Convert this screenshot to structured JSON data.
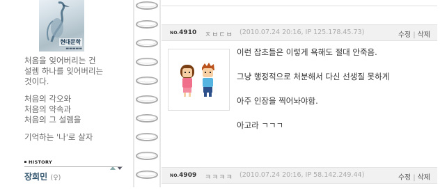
{
  "sidebar": {
    "book_cover": {
      "title": "현대문학"
    },
    "poem": {
      "stanza1": [
        "처음을 잊어버리는 건",
        "설렘 하나를 잊어버리는",
        "것이다."
      ],
      "stanza2": [
        "처음의 각오와",
        "처음의 약속과",
        "처음의 그 설렘을"
      ],
      "stanza3": [
        "기억하는 '나'로 살자"
      ]
    },
    "history": {
      "label": "HISTORY"
    },
    "member": {
      "name": "장희민",
      "gender": "(♀)"
    }
  },
  "posts": [
    {
      "no_prefix": "NO.",
      "no": "4910",
      "author": "ㅈㅂㄷㅂ",
      "meta": "(2010.07.24 20:16, IP 125.178.45.73)",
      "edit": "수정",
      "delete": "삭제",
      "lines": [
        "이런 잡초들은 이렇게 욕해도 절대 안죽음.",
        "그냥 행정적으로 처분해서 다신 선생질 못하게",
        "아주 인장을 찍어놔야함.",
        "아고라 ㄱㄱㄱ"
      ]
    },
    {
      "no_prefix": "NO.",
      "no": "4909",
      "author": "ㅋㅋㅋㅋ",
      "meta": "(2010.07.24 20:16, IP 58.142.249.44)",
      "edit": "수정",
      "delete": "삭제"
    }
  ],
  "colors": {
    "member_name": "#33566f",
    "bar_bg": "#f1f1f1"
  }
}
